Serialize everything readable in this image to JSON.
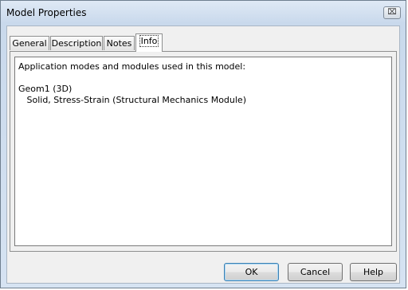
{
  "window": {
    "title": "Model Properties",
    "close_glyph": "⌧"
  },
  "tabs": [
    {
      "label": "General"
    },
    {
      "label": "Description"
    },
    {
      "label": "Notes"
    },
    {
      "label": "Info"
    }
  ],
  "active_tab": "Info",
  "info": {
    "lines": [
      "Application modes and modules used in this model:",
      "",
      "Geom1 (3D)",
      "   Solid, Stress-Strain (Structural Mechanics Module)"
    ]
  },
  "buttons": {
    "ok_label": "OK",
    "cancel_label": "Cancel",
    "help_label": "Help"
  }
}
